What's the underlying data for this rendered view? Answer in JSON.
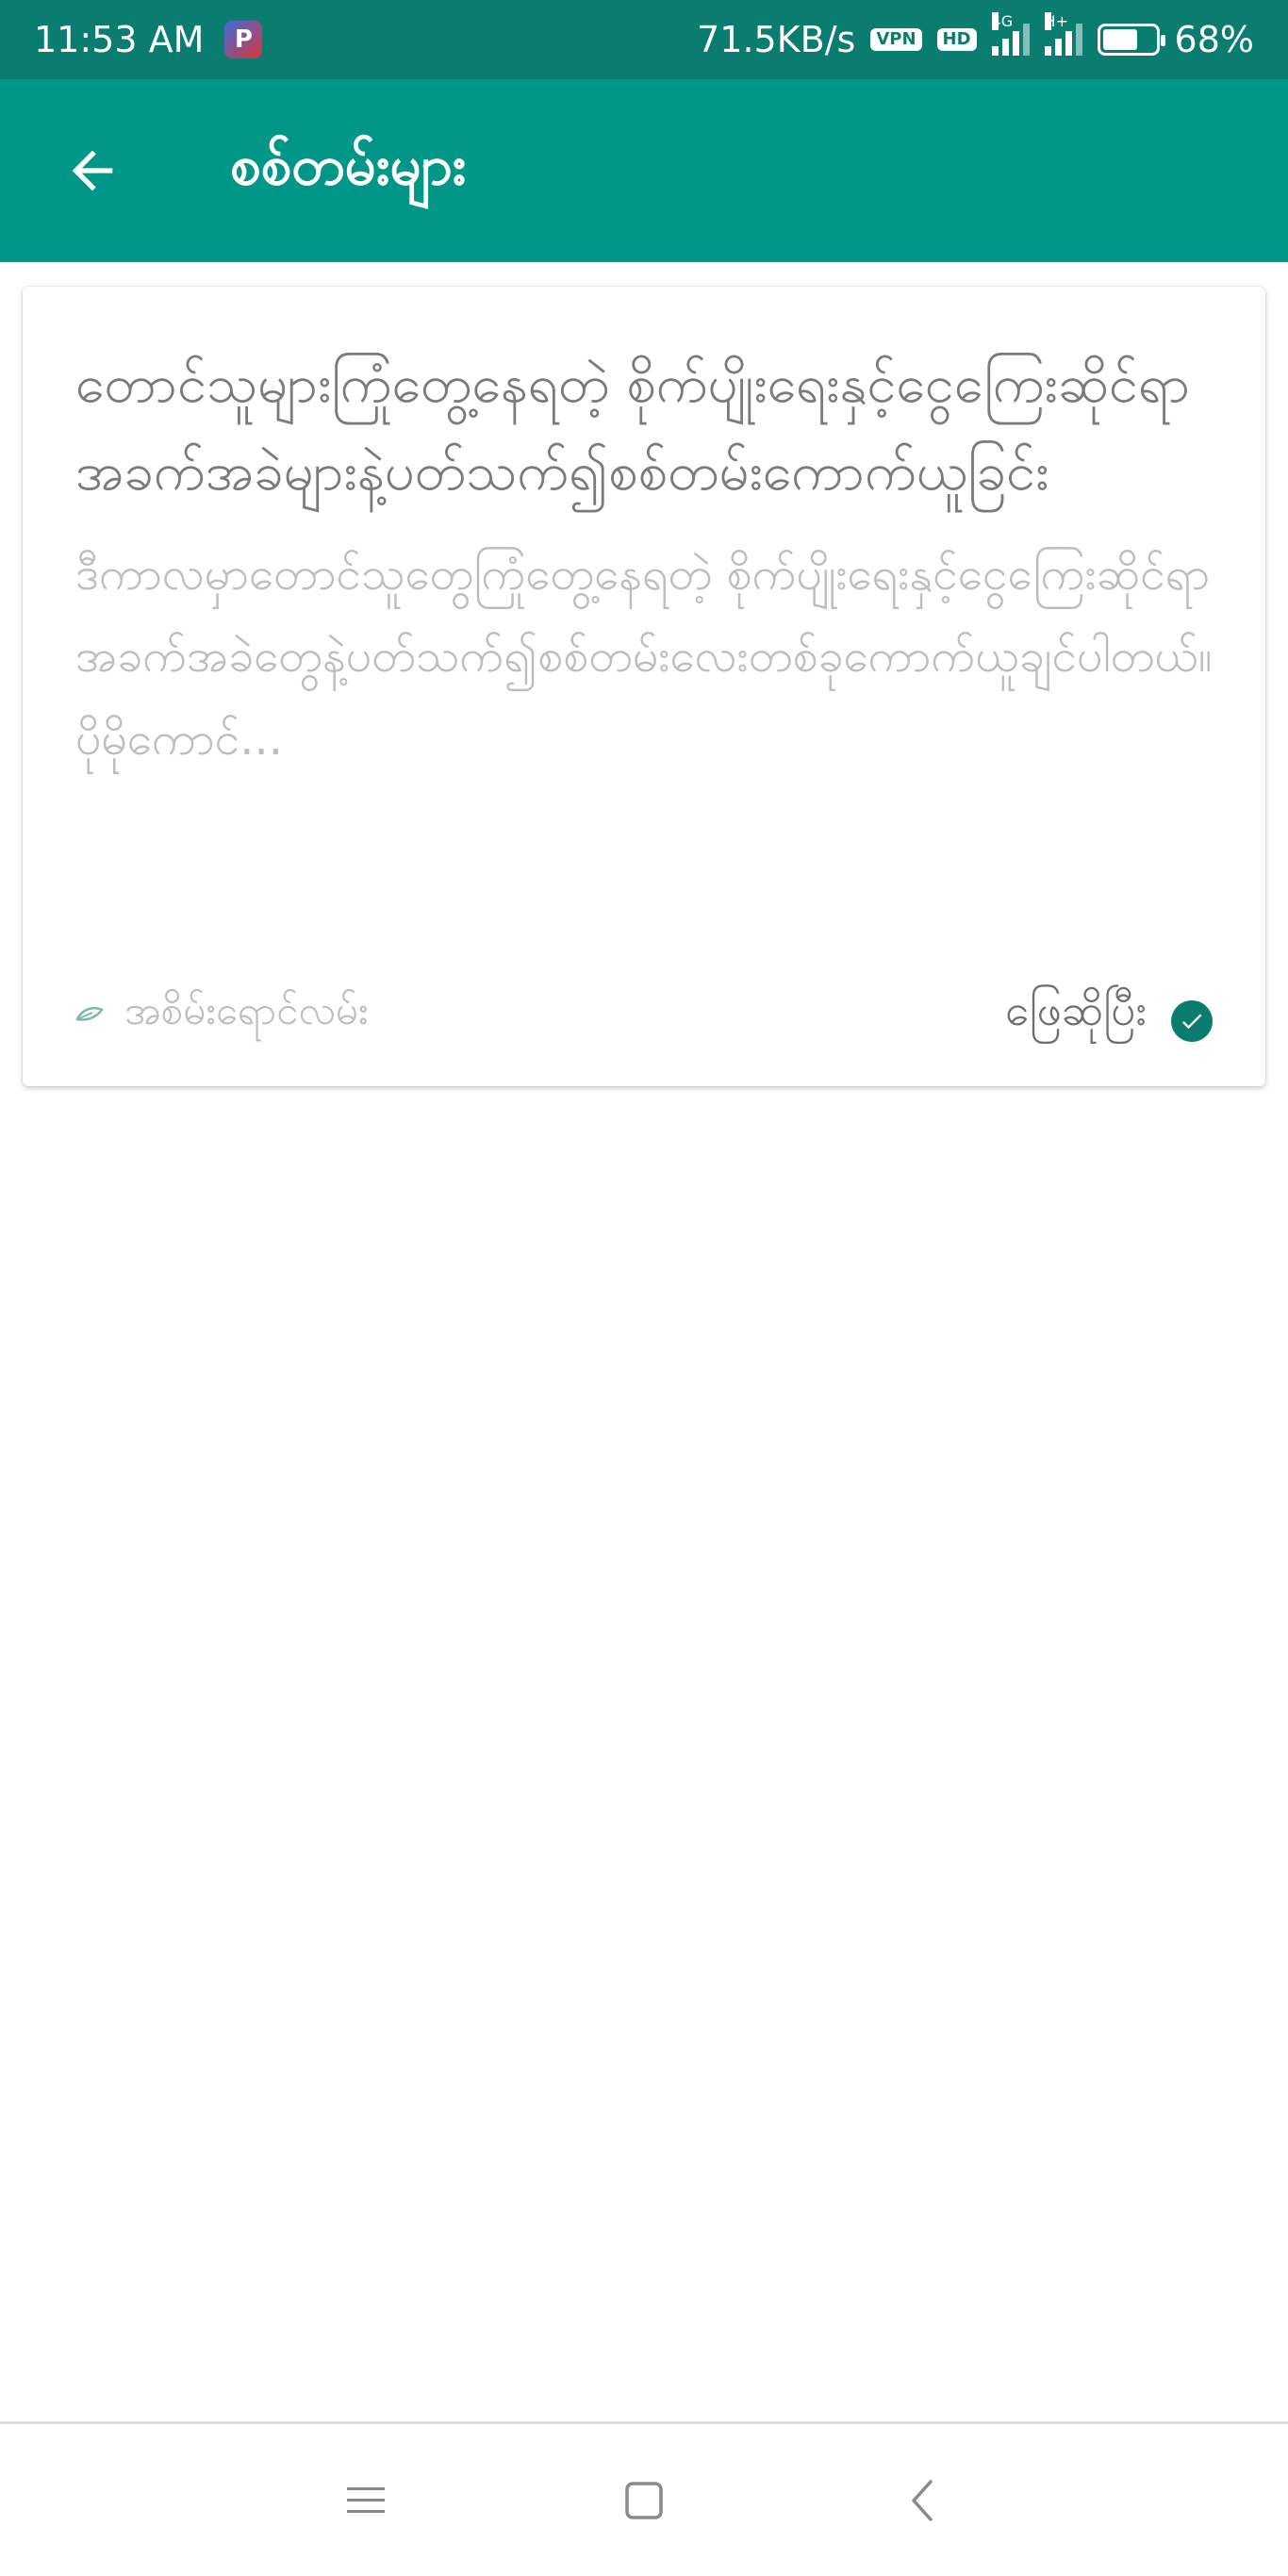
{
  "status_bar": {
    "time": "11:53 AM",
    "app_badge": "P",
    "speed": "71.5KB/s",
    "vpn": "VPN",
    "hd": "HD",
    "net1": "4G",
    "net2": "H+",
    "battery_percent": 68,
    "battery_label": "68%"
  },
  "app_bar": {
    "title": "စစ်တမ်းများ",
    "back_icon": "arrow-left-icon"
  },
  "survey": {
    "title": "တောင်သူများကြုံတွေ့နေရတဲ့ စိုက်ပျိုးရေးနှင့်ငွေကြေးဆိုင်ရာအခက်အခဲများနဲ့ပတ်သက်၍စစ်တမ်းကောက်ယူခြင်း",
    "body": "ဒီကာလမှာတောင်သူတွေကြုံတွေ့နေရတဲ့ စိုက်ပျိုးရေးနှင့်ငွေကြေးဆိုင်ရာအခက်အခဲတွေနဲ့ပတ်သက်၍စစ်တမ်းလေးတစ်ခုကောက်ယူချင်ပါတယ်။ ပိုမိုကောင်...",
    "author": "အစိမ်းရောင်လမ်း",
    "author_icon": "leaf-icon",
    "status": "ဖြေဆိုပြီး",
    "status_icon": "check-circle-icon"
  },
  "colors": {
    "status_bar": "#0b7c70",
    "app_bar": "#009688",
    "accent": "#0b7c70"
  }
}
